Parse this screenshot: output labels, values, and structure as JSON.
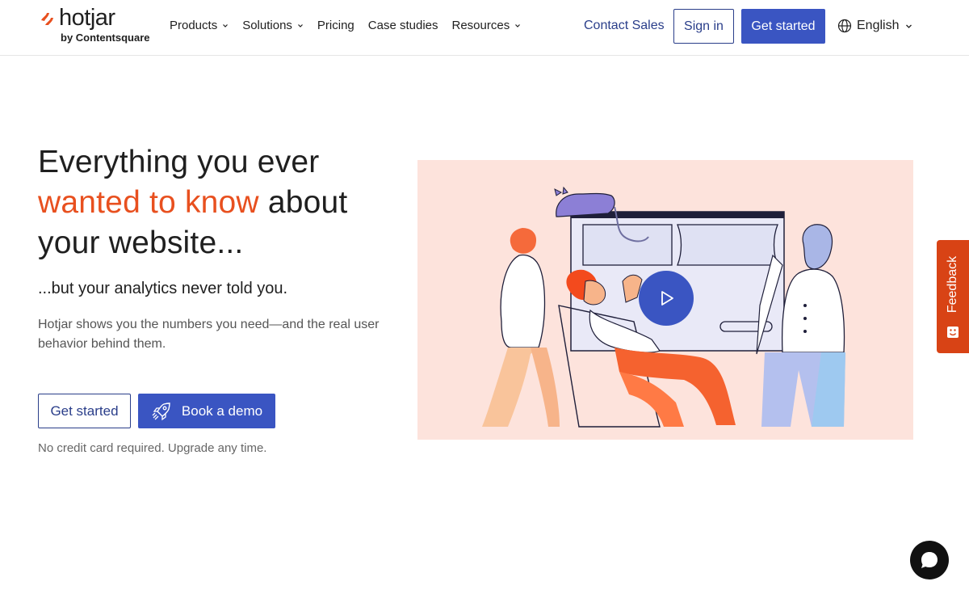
{
  "brand": {
    "name": "hotjar",
    "sub": "by Contentsquare",
    "accent_color": "#e8501f"
  },
  "nav": {
    "items": [
      {
        "label": "Products",
        "dropdown": true
      },
      {
        "label": "Solutions",
        "dropdown": true
      },
      {
        "label": "Pricing",
        "dropdown": false
      },
      {
        "label": "Case studies",
        "dropdown": false
      },
      {
        "label": "Resources",
        "dropdown": true
      }
    ],
    "contact_sales": "Contact Sales",
    "sign_in": "Sign in",
    "get_started": "Get started",
    "language": "English"
  },
  "hero": {
    "title_line1": "Everything you ever",
    "title_accent": "wanted to know",
    "title_after_accent": " about",
    "title_line3": "your website...",
    "subtitle": "...but your analytics never told you.",
    "description": "Hotjar shows you the numbers you need—and the real user behavior behind them.",
    "cta_primary": "Get started",
    "cta_demo": "Book a demo",
    "note": "No credit card required. Upgrade any time."
  },
  "illustration": {
    "background": "#fde3dc",
    "play_color": "#3a55c2"
  },
  "feedback": {
    "label": "Feedback",
    "color": "#d84315"
  },
  "colors": {
    "primary": "#3a55c2",
    "primary_dark": "#2a3e8a"
  }
}
